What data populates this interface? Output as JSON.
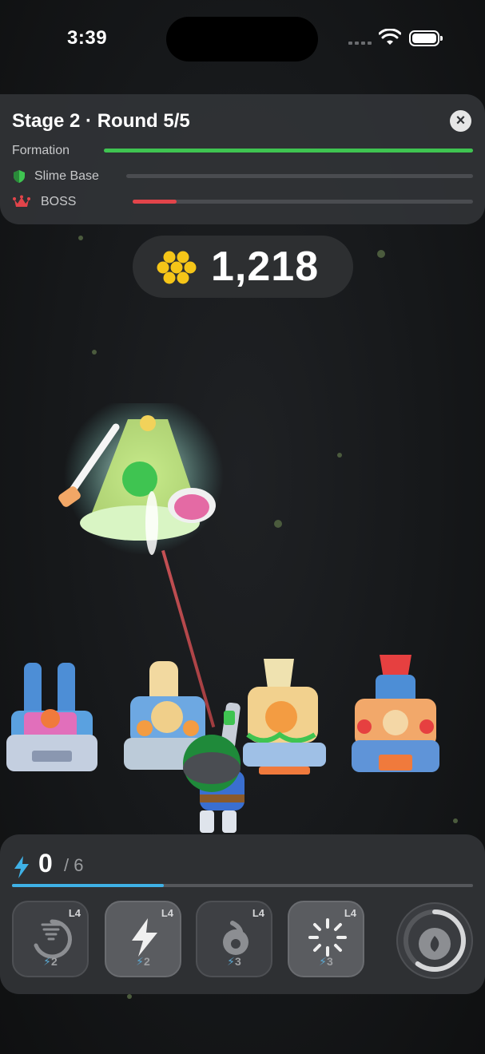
{
  "status_bar": {
    "time": "3:39"
  },
  "stage_panel": {
    "title": "Stage 2 · Round 5/5",
    "rows": [
      {
        "label": "Formation",
        "progress": 1.0,
        "color": "#3fc451"
      },
      {
        "label": "Slime Base",
        "progress": 0.0,
        "color": "#3fc451"
      },
      {
        "label": "BOSS",
        "progress": 0.13,
        "color": "#e2444a"
      }
    ]
  },
  "currency": {
    "amount": "1,218",
    "icon": "gold-coins-icon"
  },
  "energy": {
    "current": "0",
    "max": "/ 6",
    "progress": 0.33
  },
  "skills": [
    {
      "icon": "tornado-icon",
      "level": "L4",
      "cost": "2",
      "active": false
    },
    {
      "icon": "lightning-icon",
      "level": "L4",
      "cost": "2",
      "active": true
    },
    {
      "icon": "fire-bomb-icon",
      "level": "L4",
      "cost": "3",
      "active": false
    },
    {
      "icon": "burst-icon",
      "level": "L4",
      "cost": "3",
      "active": true
    }
  ],
  "ultimate": {
    "icon": "fire-ultimate-icon",
    "charge": 0.6
  },
  "colors": {
    "accent_blue": "#3fb1e6",
    "panel_bg": "#303235",
    "health_green": "#3fc451",
    "boss_red": "#e2444a"
  }
}
